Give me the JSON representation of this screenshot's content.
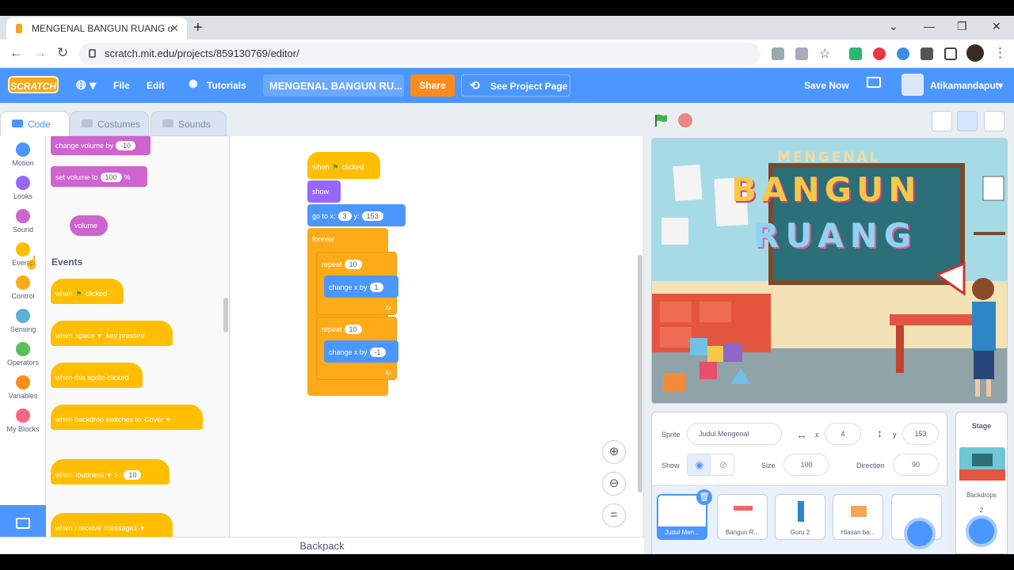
{
  "browser": {
    "tab_title": "MENGENAL BANGUN RUANG o",
    "url": "scratch.mit.edu/projects/859130769/editor/"
  },
  "menu": {
    "logo": "SCRATCH",
    "file": "File",
    "edit": "Edit",
    "tutorials": "Tutorials",
    "project_title": "MENGENAL BANGUN RU...",
    "share": "Share",
    "see_project": "See Project Page",
    "save_now": "Save Now",
    "username": "Atikamandaput"
  },
  "editor_tabs": {
    "code": "Code",
    "costumes": "Costumes",
    "sounds": "Sounds"
  },
  "categories": [
    {
      "label": "Motion",
      "color": "#4c97ff"
    },
    {
      "label": "Looks",
      "color": "#9966ff"
    },
    {
      "label": "Sound",
      "color": "#cf63cf"
    },
    {
      "label": "Events",
      "color": "#ffbf00"
    },
    {
      "label": "Control",
      "color": "#ffab19"
    },
    {
      "label": "Sensing",
      "color": "#5cb1d6"
    },
    {
      "label": "Operators",
      "color": "#59c059"
    },
    {
      "label": "Variables",
      "color": "#ff8c1a"
    },
    {
      "label": "My Blocks",
      "color": "#ff6680"
    }
  ],
  "palette": {
    "change_volume": "change volume by",
    "change_volume_val": "-10",
    "set_volume": "set volume to",
    "set_volume_val": "100",
    "set_volume_unit": "%",
    "volume": "volume",
    "events_title": "Events",
    "when_flag": "when",
    "clicked": "clicked",
    "when_key": "when",
    "key": "space",
    "key_pressed": "key pressed",
    "when_sprite_clicked": "when this sprite clicked",
    "when_backdrop": "when backdrop switches to",
    "backdrop": "Cover",
    "when_loudness": "when",
    "loudness": "loudness",
    "gt": ">",
    "loudness_val": "10",
    "when_receive": "when I receive",
    "message": "message1"
  },
  "script": {
    "hat_when": "when",
    "hat_clicked": "clicked",
    "show": "show",
    "goto": "go to x:",
    "goto_x": "3",
    "goto_y_label": "y:",
    "goto_y": "153",
    "forever": "forever",
    "repeat1": "repeat",
    "repeat1_val": "10",
    "change1": "change x by",
    "change1_val": "1",
    "repeat2": "repeat",
    "repeat2_val": "10",
    "change2": "change x by",
    "change2_val": "-1"
  },
  "backpack": "Backpack",
  "stage_art": {
    "title_small": "MENGENAL",
    "line1": "BANGUN",
    "line2": "RUANG"
  },
  "sprite_info": {
    "sprite_label": "Sprite",
    "sprite_name": "Judul Mengenal",
    "x_label": "x",
    "x": "4",
    "y_label": "y",
    "y": "153",
    "show_label": "Show",
    "size_label": "Size",
    "size": "100",
    "direction_label": "Direction",
    "direction": "90"
  },
  "sprites": [
    "Judul Men...",
    "Bangun R...",
    "Guru 2",
    "Hiasan ba...",
    ""
  ],
  "stage_panel": {
    "title": "Stage",
    "backdrops_label": "Backdrops",
    "backdrops_count": "2"
  }
}
